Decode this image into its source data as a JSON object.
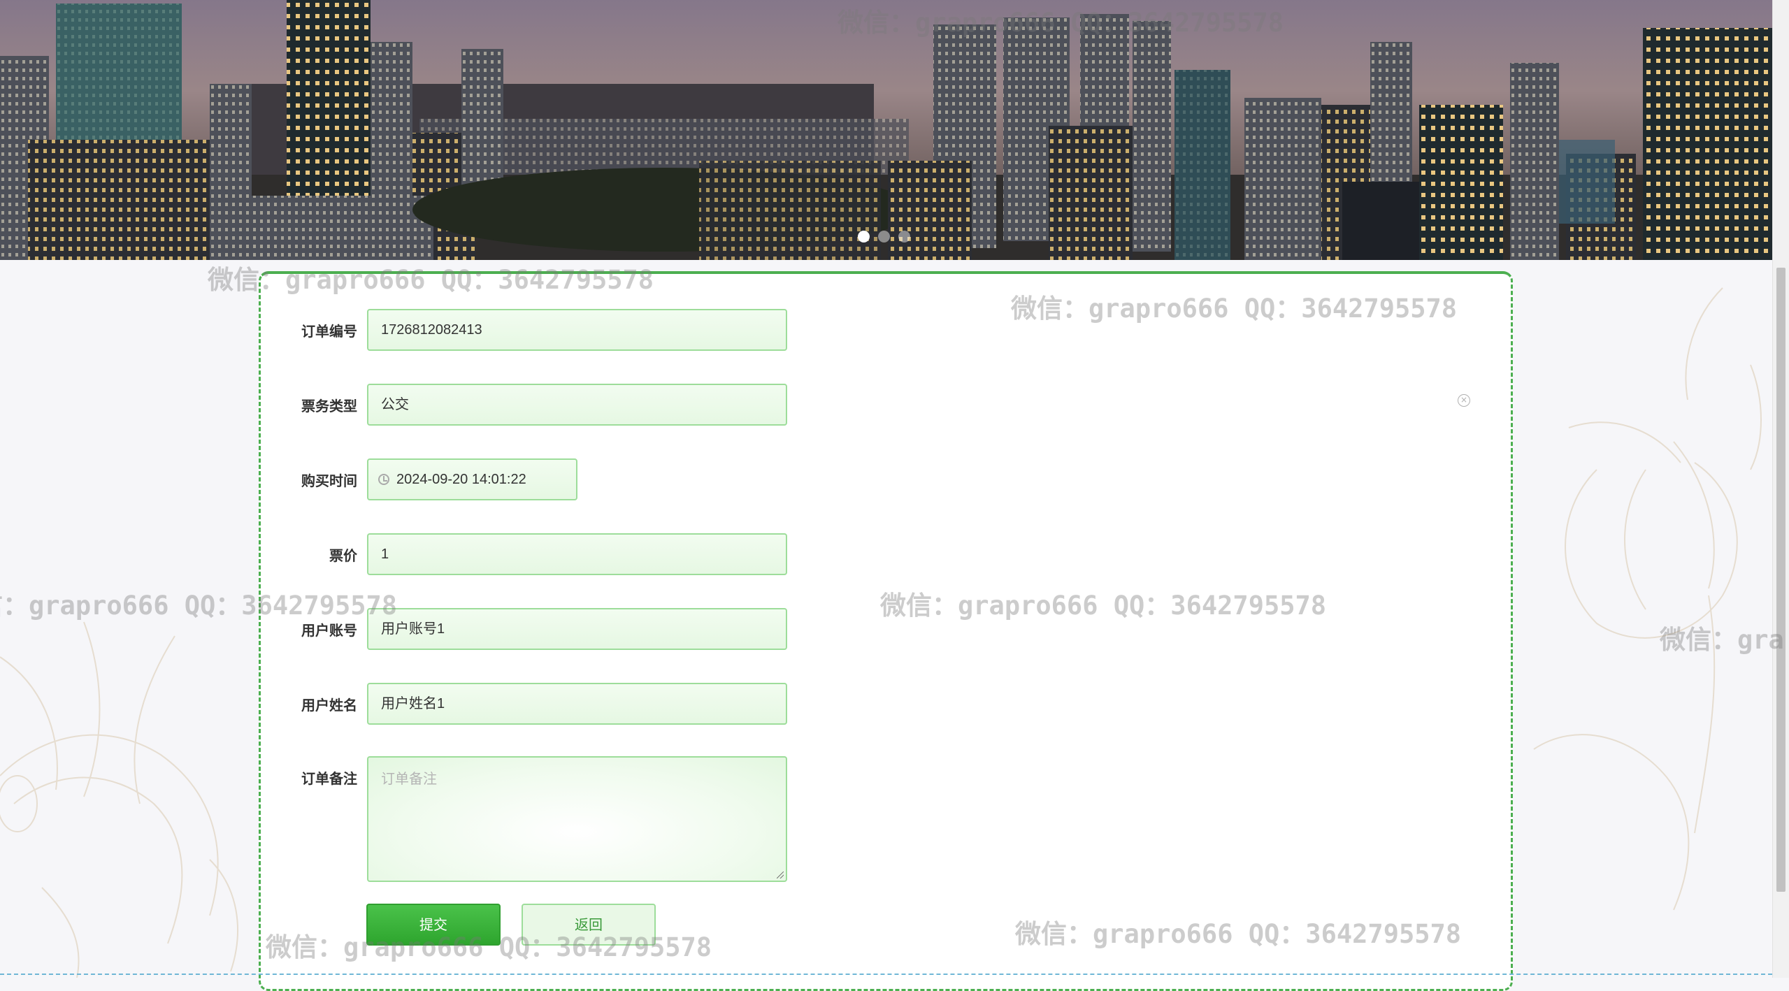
{
  "banner": {
    "slides": [
      "",
      "",
      ""
    ],
    "active_index": 0
  },
  "form": {
    "fields": [
      {
        "label": "订单编号",
        "value": "1726812082413"
      },
      {
        "label": "票务类型",
        "value": "公交"
      },
      {
        "label": "购买时间",
        "value": "2024-09-20 14:01:22"
      },
      {
        "label": "票价",
        "value": "1"
      },
      {
        "label": "用户账号",
        "value": "用户账号1"
      },
      {
        "label": "用户姓名",
        "value": "用户姓名1"
      }
    ],
    "remark": {
      "label": "订单备注",
      "placeholder": "订单备注"
    },
    "submit_label": "提交",
    "back_label": "返回"
  },
  "watermark": "微信：grapro666 QQ：3642795578",
  "watermark_partial": "微信：gra",
  "colors": {
    "accent": "#4caf50",
    "input_border": "#9ddd9a",
    "submit": "#36ad36"
  }
}
